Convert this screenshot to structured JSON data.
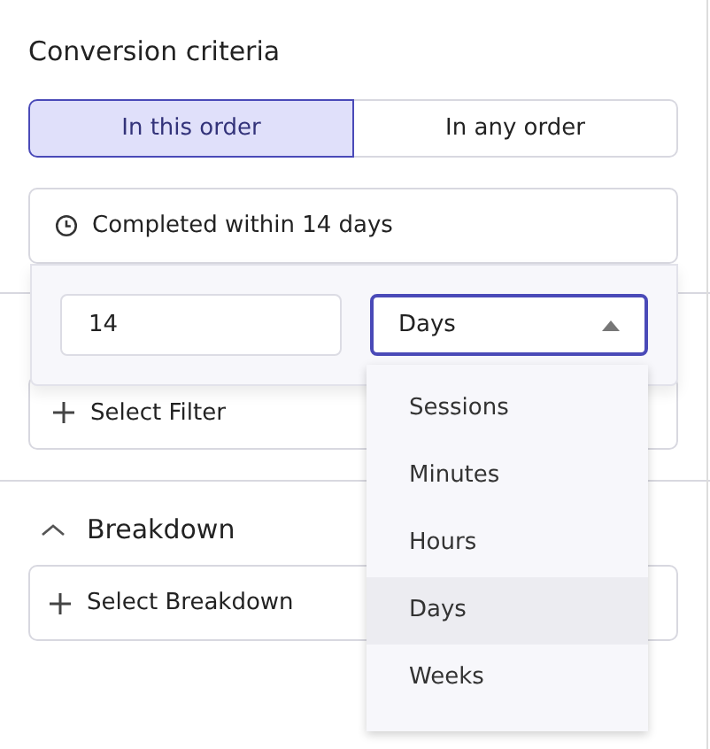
{
  "section_title": "Conversion criteria",
  "order_tabs": [
    {
      "label": "In this order",
      "selected": true
    },
    {
      "label": "In any order",
      "selected": false
    }
  ],
  "within_button": "Completed within 14 days",
  "filter_button": "Select Filter",
  "breakdown": {
    "title": "Breakdown",
    "expanded": true
  },
  "breakdown_button": "Select Breakdown",
  "popover": {
    "amount": "14",
    "unit": "Days",
    "unit_open": true
  },
  "unit_options": [
    {
      "label": "Sessions",
      "selected": false
    },
    {
      "label": "Minutes",
      "selected": false
    },
    {
      "label": "Hours",
      "selected": false
    },
    {
      "label": "Days",
      "selected": true
    },
    {
      "label": "Weeks",
      "selected": false
    }
  ]
}
